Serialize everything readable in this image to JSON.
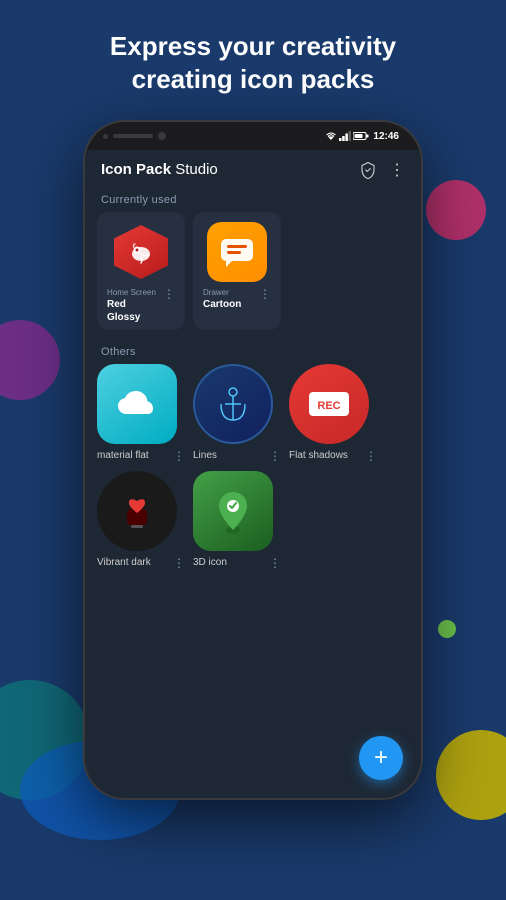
{
  "headline": {
    "line1": "Express your creativity",
    "line2": "creating icon packs"
  },
  "status_bar": {
    "time": "12:46"
  },
  "app_bar": {
    "title_bold": "Icon Pack",
    "title_regular": " Studio",
    "icon_shield": "🛡",
    "icon_more": "⋮"
  },
  "currently_used": {
    "section_label": "Currently used",
    "items": [
      {
        "sublabel": "Home Screen",
        "name": "Red Glossy",
        "icon_type": "red-glossy"
      },
      {
        "sublabel": "Drawer",
        "name": "Cartoon",
        "icon_type": "cartoon"
      }
    ]
  },
  "others": {
    "section_label": "Others",
    "items": [
      {
        "name": "material flat",
        "icon_type": "material"
      },
      {
        "name": "Lines",
        "icon_type": "lines"
      },
      {
        "name": "Flat shadows",
        "icon_type": "flat-shadows"
      },
      {
        "name": "Vibrant dark",
        "icon_type": "vibrant-dark"
      },
      {
        "name": "3D icon",
        "icon_type": "3d-icon"
      }
    ]
  },
  "fab": {
    "label": "+"
  }
}
